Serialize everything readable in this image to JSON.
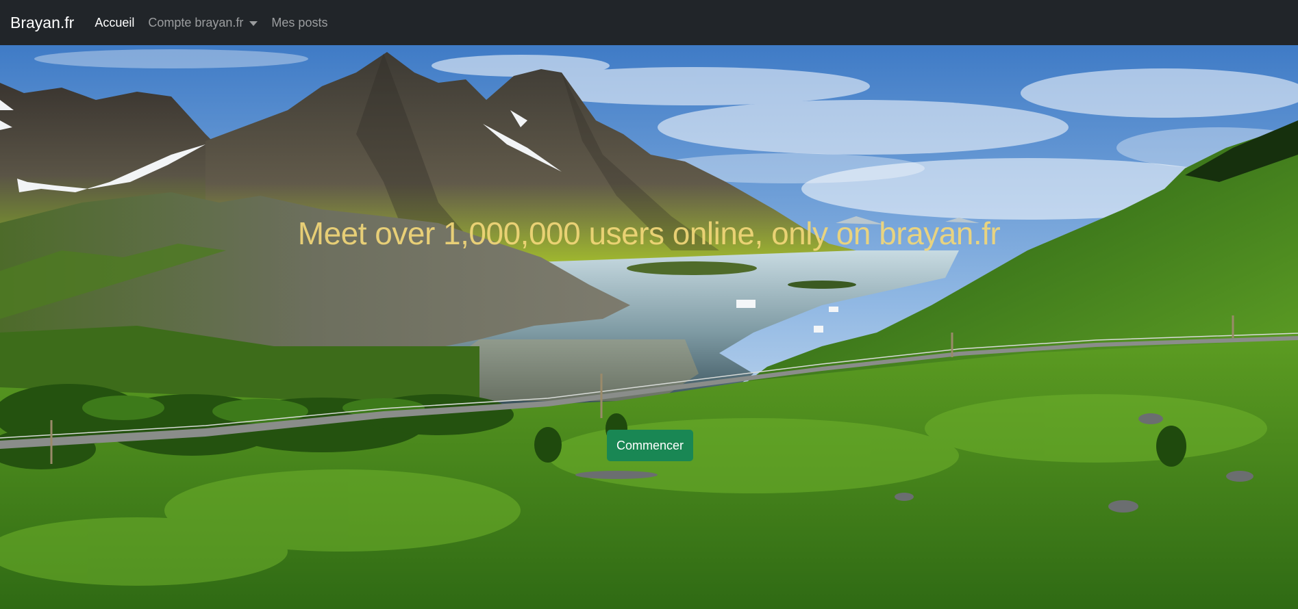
{
  "navbar": {
    "brand": "Brayan.fr",
    "links": [
      {
        "label": "Accueil",
        "active": true
      },
      {
        "label": "Compte brayan.fr",
        "dropdown": true
      },
      {
        "label": "Mes posts"
      }
    ]
  },
  "hero": {
    "headline": "Meet over 1,000,000 users online, only on brayan.fr",
    "cta_label": "Commencer",
    "background": "mountain-fjord-landscape-image"
  },
  "colors": {
    "navbar_bg": "#212529",
    "headline": "#f2d779",
    "cta_bg": "#198754"
  }
}
